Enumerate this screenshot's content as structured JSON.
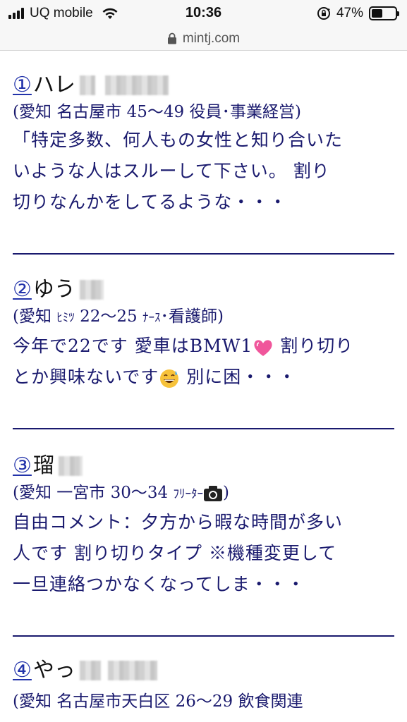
{
  "status_bar": {
    "carrier": "UQ mobile",
    "time": "10:36",
    "battery_percent": "47%",
    "battery_level": 0.47
  },
  "browser": {
    "url": "mintj.com"
  },
  "entries": [
    {
      "number": "①",
      "name": "ハレ",
      "meta": "(愛知 名古屋市 45〜49 役員･事業経営)",
      "comment_lines": [
        "「特定多数、何人もの女性と知り合いた",
        "いような人はスルーして下さい。 割り",
        "切りなんかをしてるような・・・"
      ]
    },
    {
      "number": "②",
      "name": "ゆう",
      "meta_prefix": "(愛知 ",
      "meta_kana": "ﾋﾐﾂ",
      "meta_mid": " 22〜25 ",
      "meta_kana2": "ﾅｰｽ",
      "meta_suffix": "･看護師)",
      "comment_lines": [
        "今年で22です 愛車はBMW1",
        " 割り切り",
        "とか興味ないです",
        " 別に困・・・"
      ]
    },
    {
      "number": "③",
      "name": "瑠",
      "meta_prefix": "(愛知 一宮市 30〜34 ",
      "meta_kana": "ﾌﾘｰﾀｰ",
      "meta_suffix": ")",
      "comment_lines": [
        "自由コメント：夕方から暇な時間が多い",
        "人です 割り切りタイプ ※機種変更して",
        "一旦連絡つかなくなってしま・・・"
      ]
    },
    {
      "number": "④",
      "name": "やっ",
      "meta": "(愛知 名古屋市天白区 26〜29 飲食関連"
    }
  ],
  "colors": {
    "text": "#1a1a6e",
    "link": "#2233aa",
    "divider": "#1a1a6e",
    "bar_bg": "#f7f7f7"
  }
}
